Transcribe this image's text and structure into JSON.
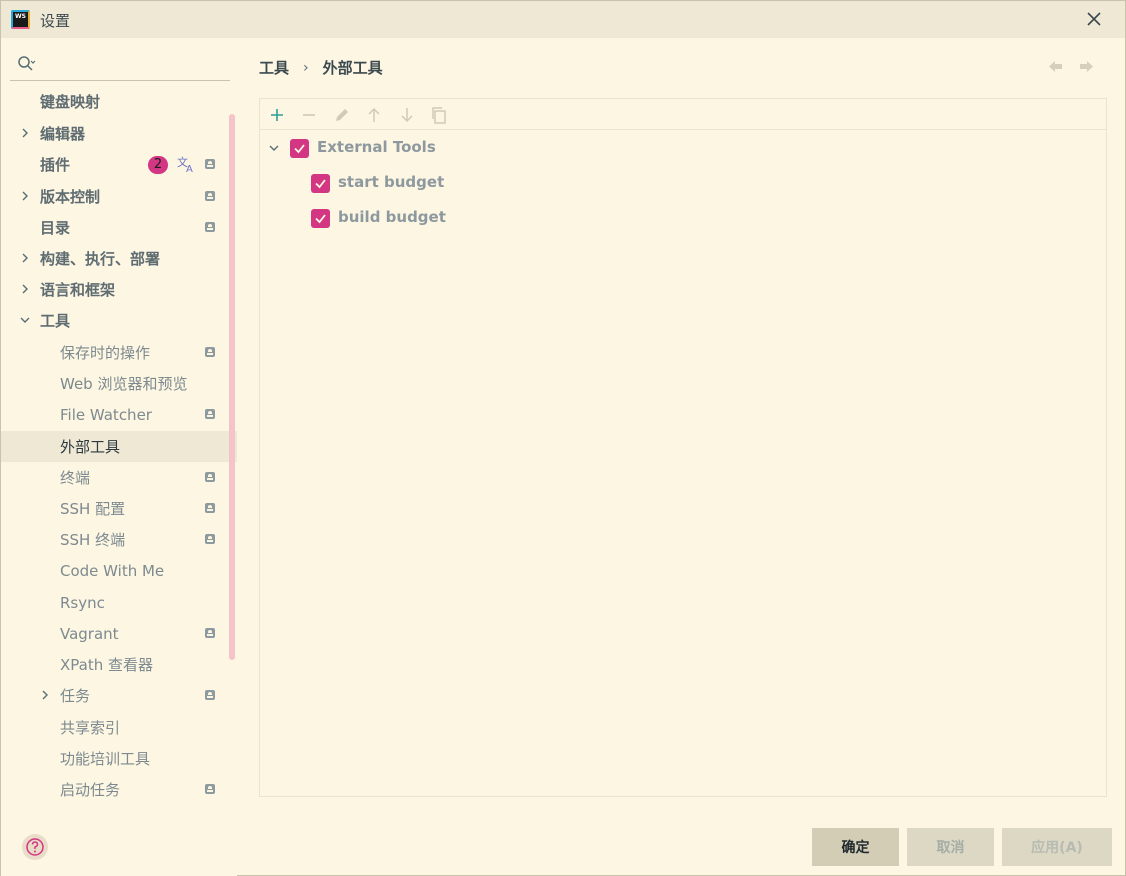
{
  "window": {
    "title": "设置",
    "app_icon_text": "WS"
  },
  "sidebar": {
    "search_placeholder": "",
    "items": [
      {
        "label": "键盘映射"
      },
      {
        "label": "编辑器"
      },
      {
        "label": "插件",
        "badge": "2"
      },
      {
        "label": "版本控制"
      },
      {
        "label": "目录"
      },
      {
        "label": "构建、执行、部署"
      },
      {
        "label": "语言和框架"
      },
      {
        "label": "工具"
      },
      {
        "label": "保存时的操作"
      },
      {
        "label": "Web 浏览器和预览"
      },
      {
        "label": "File Watcher"
      },
      {
        "label": "外部工具"
      },
      {
        "label": "终端"
      },
      {
        "label": "SSH 配置"
      },
      {
        "label": "SSH 终端"
      },
      {
        "label": "Code With Me"
      },
      {
        "label": "Rsync"
      },
      {
        "label": "Vagrant"
      },
      {
        "label": "XPath 查看器"
      },
      {
        "label": "任务"
      },
      {
        "label": "共享索引"
      },
      {
        "label": "功能培训工具"
      },
      {
        "label": "启动任务"
      }
    ]
  },
  "breadcrumb": {
    "parent": "工具",
    "separator": "›",
    "current": "外部工具"
  },
  "tree": {
    "root": {
      "label": "External Tools",
      "checked": true
    },
    "children": [
      {
        "label": "start budget",
        "checked": true
      },
      {
        "label": "build budget",
        "checked": true
      }
    ]
  },
  "buttons": {
    "ok": "确定",
    "cancel": "取消",
    "apply": "应用(A)"
  },
  "colors": {
    "accent": "#d33682",
    "background": "#fdf6e3",
    "selected": "#eee8d5",
    "add_icon": "#2aa198"
  }
}
